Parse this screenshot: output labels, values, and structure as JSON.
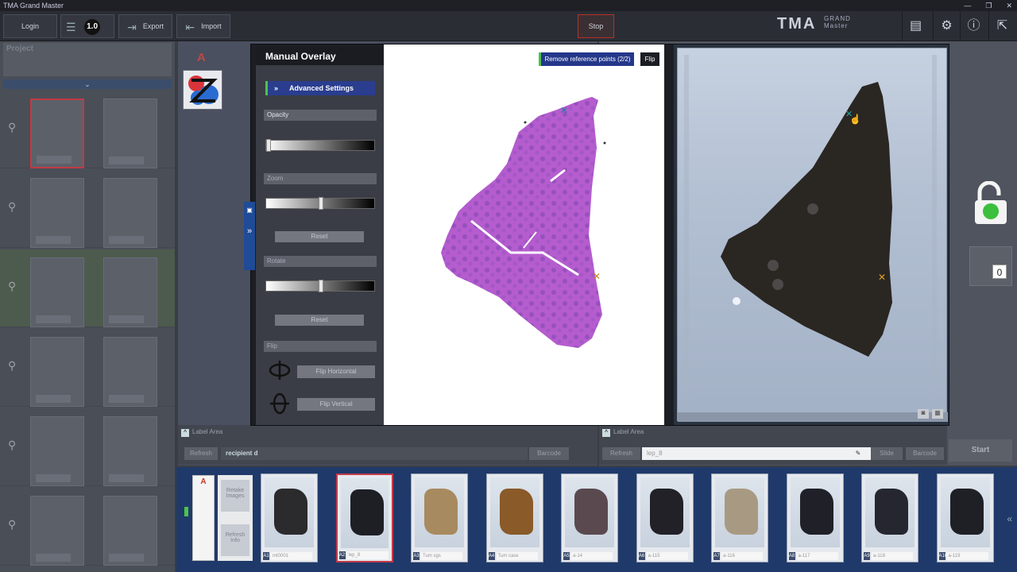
{
  "window": {
    "title": "TMA Grand Master"
  },
  "toolbar": {
    "login": "Login",
    "zoom_value": "1.0",
    "export": "Export",
    "import": "Import",
    "stop": "Stop",
    "brand": "TMA",
    "brand_sub1": "GRAND",
    "brand_sub2": "Master"
  },
  "left_panel": {
    "project_label": "Project"
  },
  "center": {
    "row_letter": "A"
  },
  "dialog": {
    "title": "Manual Overlay",
    "advanced_settings": "Advanced Settings",
    "opacity": "Opacity",
    "opacity_level": 0.0,
    "zoom": "Zoom",
    "zoom_level": 0.5,
    "zoom_reset": "Reset",
    "rotate": "Rotate",
    "rotate_level": 0.5,
    "rotate_reset": "Reset",
    "flip": "Flip",
    "flip_horizontal": "Flip Horizontal",
    "flip_vertical": "Flip Vertical",
    "remove_points": "Remove reference points (2/2)",
    "flip_button": "Flip"
  },
  "label_left": {
    "title": "Label Area",
    "refresh": "Refresh",
    "value": "recipient d",
    "barcode": "Barcode"
  },
  "label_right": {
    "title": "Label Area",
    "refresh": "Refresh",
    "value": "lep_8",
    "slide": "Slide",
    "barcode": "Barcode"
  },
  "start": "Start",
  "counter": "0",
  "strip": {
    "row_letter": "A",
    "action_top": "Retake Images",
    "action_bottom": "Refresh Info",
    "slides": [
      {
        "pos": "A1",
        "label": "mt0001",
        "tissue": "#2b2a2c"
      },
      {
        "pos": "A2",
        "label": "lep_8",
        "tissue": "#1e1f25"
      },
      {
        "pos": "A3",
        "label": "Tum sgs",
        "tissue": "#a88a60"
      },
      {
        "pos": "A4",
        "label": "Tum case",
        "tissue": "#8a5a28"
      },
      {
        "pos": "A5",
        "label": "a-14",
        "tissue": "#5a4a50"
      },
      {
        "pos": "A6",
        "label": "a-115",
        "tissue": "#222128"
      },
      {
        "pos": "A7",
        "label": "a-116",
        "tissue": "#a89a82"
      },
      {
        "pos": "A8",
        "label": "a-117",
        "tissue": "#202128"
      },
      {
        "pos": "A9",
        "label": "a-118",
        "tissue": "#252630"
      },
      {
        "pos": "A10",
        "label": "a-119",
        "tissue": "#1f2025"
      }
    ]
  },
  "colors": {
    "accent_blue": "#24378a",
    "accent_green": "#4cc24c",
    "selected_red": "#c43a48"
  }
}
